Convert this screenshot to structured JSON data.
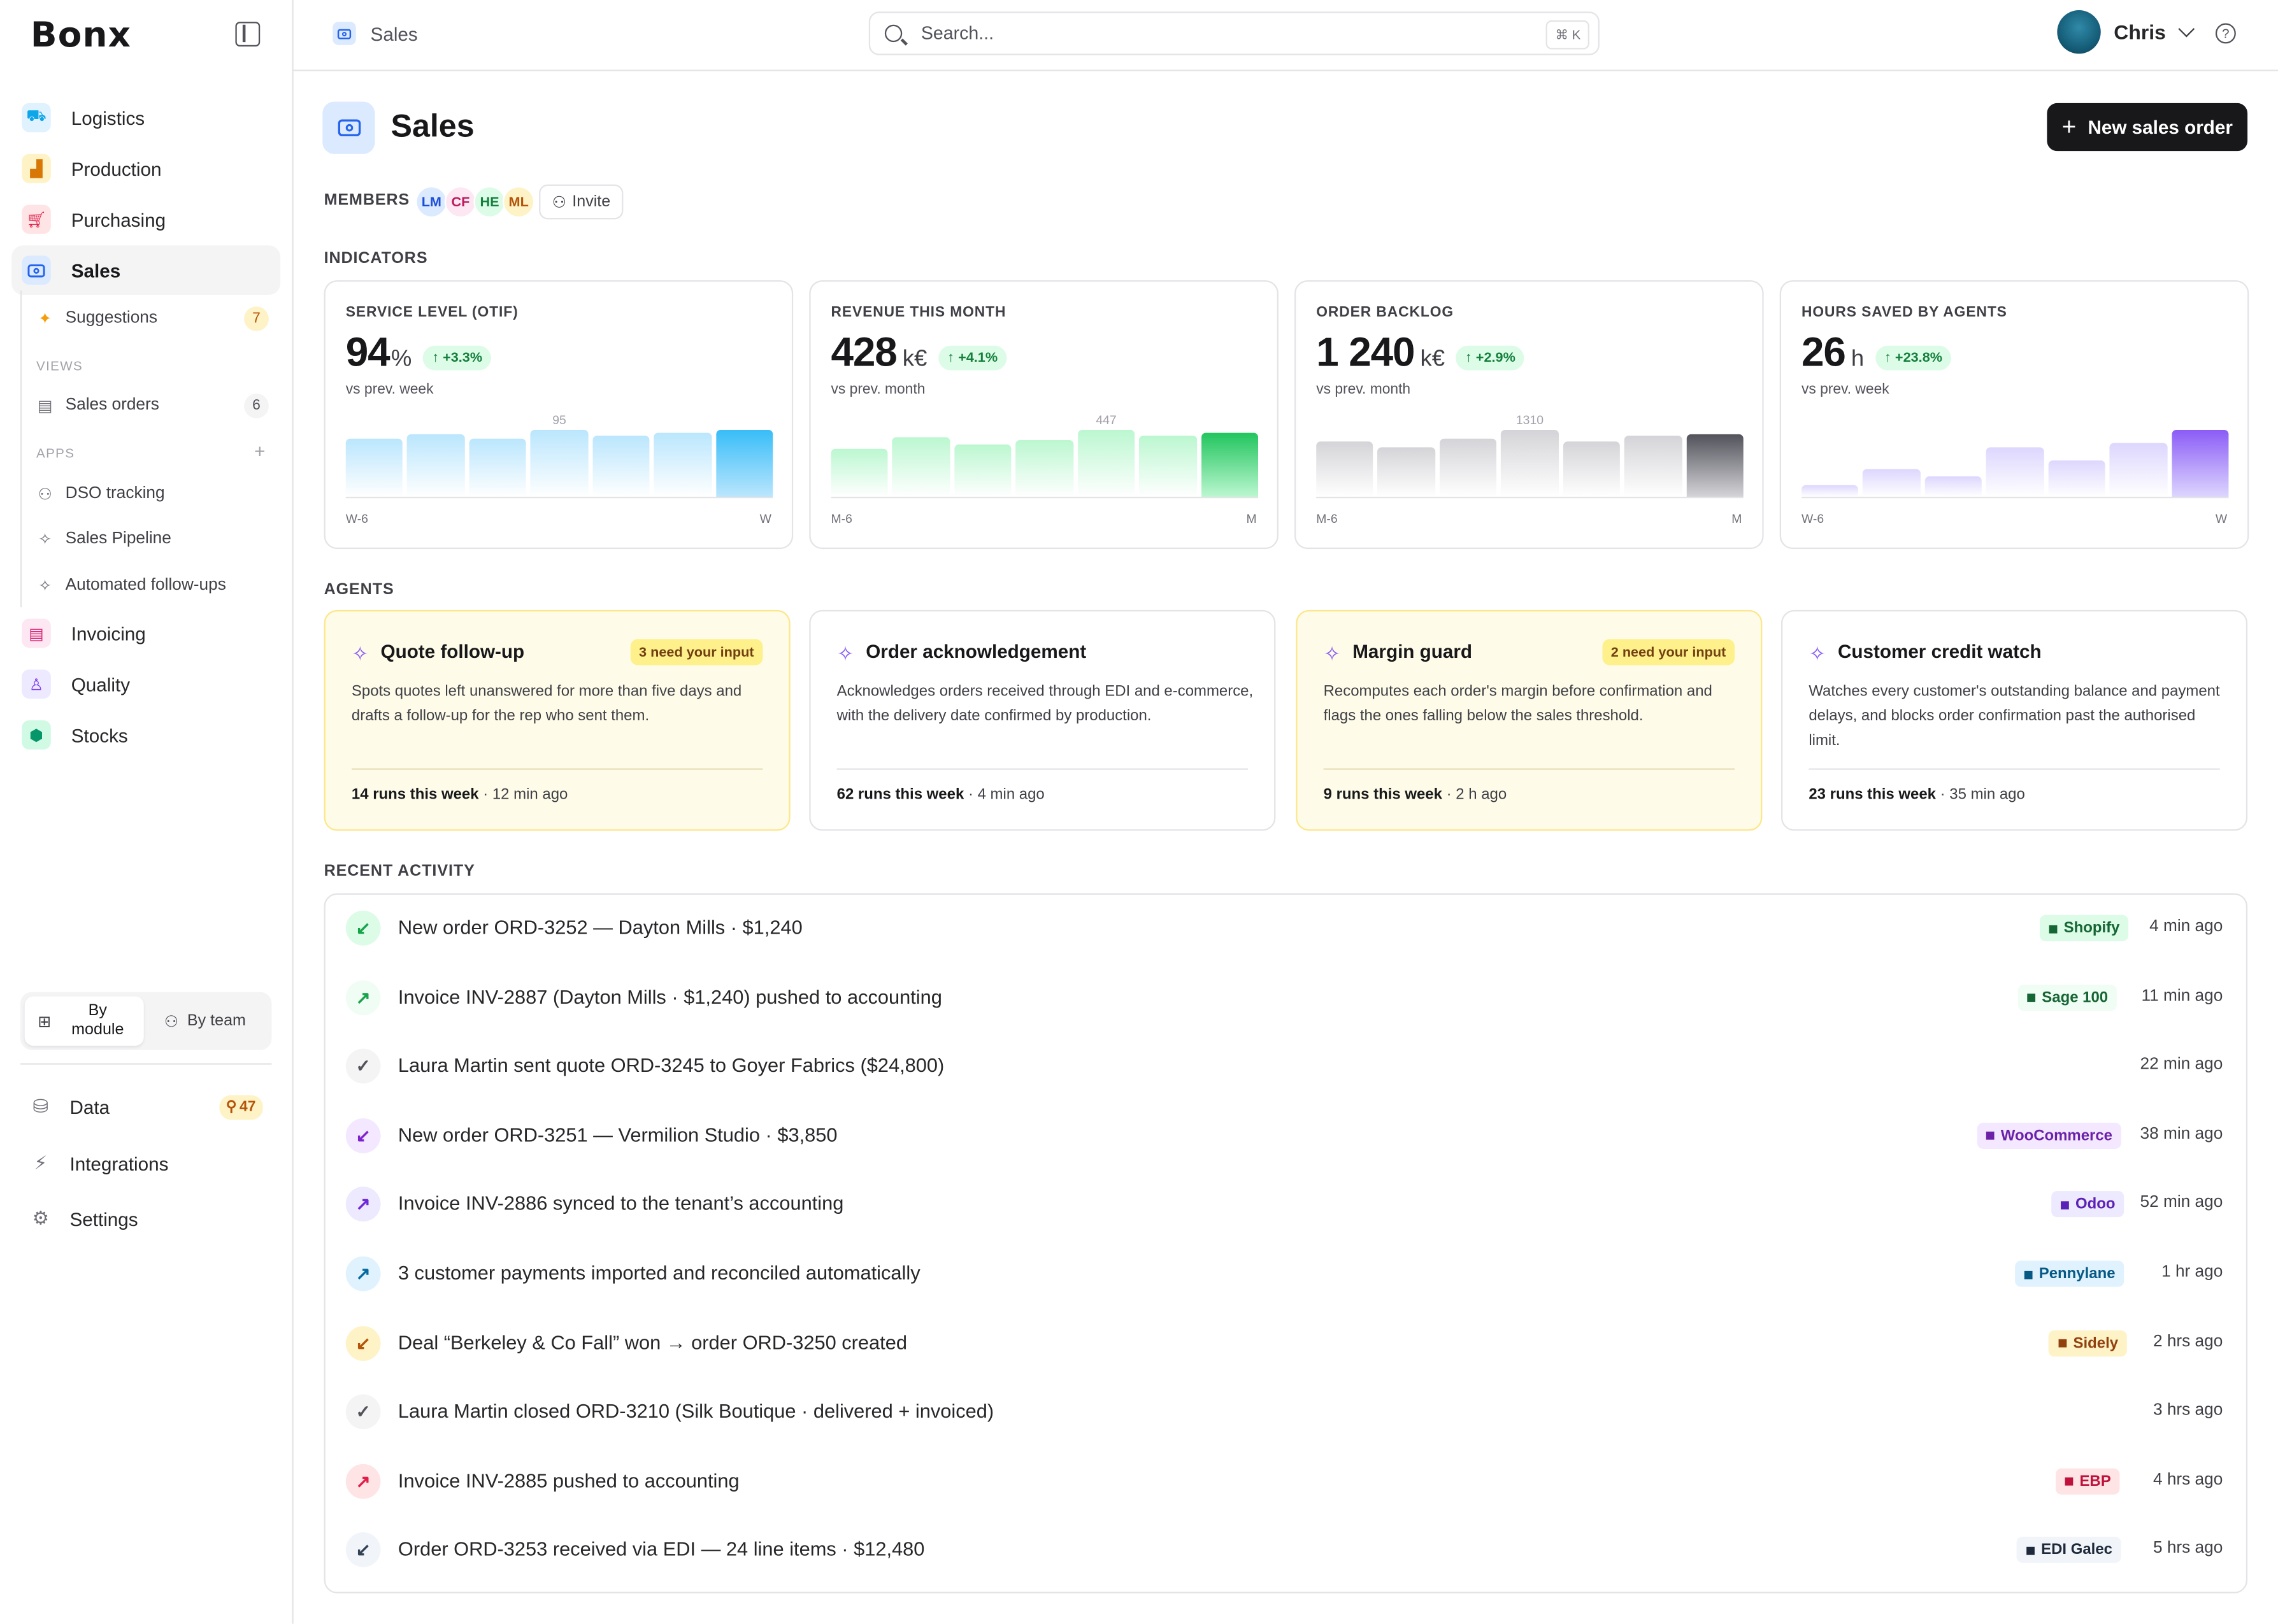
{
  "app": {
    "logo": "Bonx"
  },
  "sidebar": {
    "items": [
      {
        "label": "Logistics",
        "icon": "truck-icon",
        "color": "#0ea5e9",
        "bg": "#e0f2fe"
      },
      {
        "label": "Production",
        "icon": "factory-icon",
        "color": "#d97706",
        "bg": "#fef3c7"
      },
      {
        "label": "Purchasing",
        "icon": "cart-icon",
        "color": "#e11d48",
        "bg": "#ffe4e6"
      },
      {
        "label": "Sales",
        "icon": "banknote-icon",
        "color": "#2563eb",
        "bg": "#dbeafe"
      }
    ],
    "suggestions": {
      "label": "Suggestions",
      "count": "7"
    },
    "views_label": "VIEWS",
    "sales_orders": {
      "label": "Sales orders",
      "count": "6"
    },
    "apps_label": "APPS",
    "apps_add": "+",
    "apps": [
      "DSO tracking",
      "Sales Pipeline",
      "Automated follow-ups"
    ],
    "items2": [
      {
        "label": "Invoicing",
        "icon": "invoice-icon"
      },
      {
        "label": "Quality",
        "icon": "ribbon-icon"
      },
      {
        "label": "Stocks",
        "icon": "box-icon"
      }
    ],
    "toggle": {
      "by_module": "By module",
      "by_team": "By team"
    },
    "bottom": {
      "data": "Data",
      "data_count": "47",
      "integrations": "Integrations",
      "settings": "Settings"
    }
  },
  "topbar": {
    "breadcrumb": "Sales",
    "search_placeholder": "Search...",
    "search_shortcut": "⌘ K",
    "user_name": "Chris",
    "help": "?"
  },
  "page": {
    "title": "Sales",
    "new_button": "New sales order",
    "members_label": "MEMBERS",
    "members": [
      {
        "initials": "LM",
        "bg": "#dbeafe",
        "fg": "#1d4ed8"
      },
      {
        "initials": "CF",
        "bg": "#fce7f3",
        "fg": "#be185d"
      },
      {
        "initials": "HE",
        "bg": "#dcfce7",
        "fg": "#15803d"
      },
      {
        "initials": "ML",
        "bg": "#fef3c7",
        "fg": "#b45309"
      }
    ],
    "invite": "Invite",
    "indicators_label": "INDICATORS",
    "agents_label": "AGENTS",
    "activity_label": "RECENT ACTIVITY"
  },
  "indicators": [
    {
      "label": "SERVICE LEVEL (OTIF)",
      "value": "94",
      "unit": "%",
      "delta": "↑ +3.3%",
      "sub": "vs prev. week",
      "peak": "95",
      "peak_index": 3,
      "axis_start": "W-6",
      "axis_end": "W",
      "bars": [
        40,
        43,
        40,
        46,
        42,
        44,
        46
      ],
      "ymax": 46,
      "color": "#bae6fd",
      "last_color": "#38bdf8"
    },
    {
      "label": "REVENUE THIS MONTH",
      "value": "428",
      "unit": "k€",
      "delta": "↑ +4.1%",
      "sub": "vs prev. month",
      "peak": "447",
      "peak_index": 4,
      "axis_start": "M-6",
      "axis_end": "M",
      "bars": [
        33,
        41,
        36,
        39,
        46,
        42,
        44
      ],
      "ymax": 46,
      "color": "#bbf7d0",
      "last_color": "#22c55e"
    },
    {
      "label": "ORDER BACKLOG",
      "value": "1 240",
      "unit": "k€",
      "delta": "↑ +2.9%",
      "sub": "vs prev. month",
      "peak": "1310",
      "peak_index": 3,
      "axis_start": "M-6",
      "axis_end": "M",
      "bars": [
        38,
        34,
        40,
        46,
        38,
        42,
        43
      ],
      "ymax": 46,
      "color": "#d4d4d8",
      "last_color": "#52525b"
    },
    {
      "label": "HOURS SAVED BY AGENTS",
      "value": "26",
      "unit": "h",
      "delta": "↑ +23.8%",
      "sub": "vs prev. week",
      "peak": "",
      "peak_index": -1,
      "axis_start": "W-6",
      "axis_end": "W",
      "bars": [
        8,
        19,
        14,
        34,
        25,
        37,
        46
      ],
      "ymax": 46,
      "color": "#ddd6fe",
      "last_color": "#8b5cf6"
    }
  ],
  "agents": [
    {
      "title": "Quote follow-up",
      "badge": "3 need your input",
      "desc": "Spots quotes left unanswered for more than five days and drafts a follow-up for the rep who sent them.",
      "runs": "14 runs this week",
      "when": "· 12 min ago",
      "warn": true
    },
    {
      "title": "Order acknowledgement",
      "badge": "",
      "desc": "Acknowledges orders received through EDI and e-commerce, with the delivery date confirmed by production.",
      "runs": "62 runs this week",
      "when": "· 4 min ago",
      "warn": false
    },
    {
      "title": "Margin guard",
      "badge": "2 need your input",
      "desc": "Recomputes each order's margin before confirmation and flags the ones falling below the sales threshold.",
      "runs": "9 runs this week",
      "when": "· 2 h ago",
      "warn": true
    },
    {
      "title": "Customer credit watch",
      "badge": "",
      "desc": "Watches every customer's outstanding balance and payment delays, and blocks order confirmation past the authorised limit.",
      "runs": "23 runs this week",
      "when": "· 35 min ago",
      "warn": false
    }
  ],
  "activity": [
    {
      "text": "New order ORD-3252 — Dayton Mills · $1,240",
      "source": "Shopify",
      "time": "4 min ago",
      "icon": "arrow-down-left-icon",
      "glyph": "↙",
      "icon_bg": "#dcfce7",
      "icon_fg": "#16a34a",
      "src_bg": "#dcfce7",
      "src_fg": "#166534"
    },
    {
      "text": "Invoice INV-2887 (Dayton Mills · $1,240) pushed to accounting",
      "source": "Sage 100",
      "time": "11 min ago",
      "icon": "arrow-up-right-icon",
      "glyph": "↗",
      "icon_bg": "#f0fdf4",
      "icon_fg": "#16a34a",
      "src_bg": "#f0fdf4",
      "src_fg": "#166534"
    },
    {
      "text": "Laura Martin sent quote ORD-3245 to Goyer Fabrics ($24,800)",
      "source": "",
      "time": "22 min ago",
      "icon": "check-circle-icon",
      "glyph": "✓",
      "icon_bg": "#f4f4f5",
      "icon_fg": "#52525b",
      "src_bg": "",
      "src_fg": ""
    },
    {
      "text": "New order ORD-3251 — Vermilion Studio · $3,850",
      "source": "WooCommerce",
      "time": "38 min ago",
      "icon": "arrow-down-left-icon",
      "glyph": "↙",
      "icon_bg": "#f3e8ff",
      "icon_fg": "#7e22ce",
      "src_bg": "#f3e8ff",
      "src_fg": "#6b21a8"
    },
    {
      "text": "Invoice INV-2886 synced to the tenant’s accounting",
      "source": "Odoo",
      "time": "52 min ago",
      "icon": "arrow-up-right-icon",
      "glyph": "↗",
      "icon_bg": "#ede9fe",
      "icon_fg": "#6d28d9",
      "src_bg": "#ede9fe",
      "src_fg": "#5b21b6"
    },
    {
      "text": "3 customer payments imported and reconciled automatically",
      "source": "Pennylane",
      "time": "1 hr ago",
      "icon": "arrow-up-right-icon",
      "glyph": "↗",
      "icon_bg": "#e0f2fe",
      "icon_fg": "#0369a1",
      "src_bg": "#e0f2fe",
      "src_fg": "#075985"
    },
    {
      "text": "Deal “Berkeley & Co Fall” won → order ORD-3250 created",
      "source": "Sidely",
      "time": "2 hrs ago",
      "icon": "arrow-down-left-icon",
      "glyph": "↙",
      "icon_bg": "#fef3c7",
      "icon_fg": "#b45309",
      "src_bg": "#fef3c7",
      "src_fg": "#92400e"
    },
    {
      "text": "Laura Martin closed ORD-3210 (Silk Boutique · delivered + invoiced)",
      "source": "",
      "time": "3 hrs ago",
      "icon": "check-circle-icon",
      "glyph": "✓",
      "icon_bg": "#f4f4f5",
      "icon_fg": "#52525b",
      "src_bg": "",
      "src_fg": ""
    },
    {
      "text": "Invoice INV-2885 pushed to accounting",
      "source": "EBP",
      "time": "4 hrs ago",
      "icon": "arrow-up-right-icon",
      "glyph": "↗",
      "icon_bg": "#ffe4e6",
      "icon_fg": "#e11d48",
      "src_bg": "#ffe4e6",
      "src_fg": "#be123c"
    },
    {
      "text": "Order ORD-3253 received via EDI — 24 line items · $12,480",
      "source": "EDI Galec",
      "time": "5 hrs ago",
      "icon": "arrow-down-left-icon",
      "glyph": "↙",
      "icon_bg": "#f1f5f9",
      "icon_fg": "#334155",
      "src_bg": "#f1f5f9",
      "src_fg": "#1e293b"
    }
  ]
}
